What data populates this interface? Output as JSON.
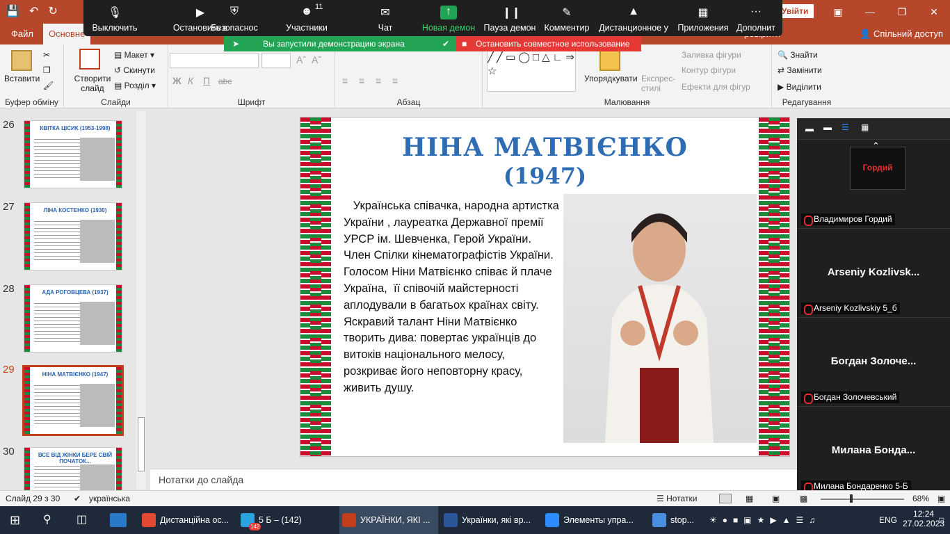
{
  "titlebar": {
    "signin": "Увійти"
  },
  "tabs": {
    "file": "Файл",
    "home": "Основне",
    "share": "Спільний доступ",
    "extra": "ревірити"
  },
  "ribbon": {
    "paste": "Вставити",
    "clipboard": "Буфер обміну",
    "new_slide": "Створити слайд",
    "layout": "Макет",
    "reset": "Скинути",
    "section": "Розділ",
    "slides": "Слайди",
    "bold": "Ж",
    "italic": "К",
    "underline": "П",
    "strike": "abc",
    "font": "Шрифт",
    "paragraph": "Абзац",
    "arrange": "Упорядкувати",
    "quick_styles": "Експрес-стилі",
    "fill": "Заливка фігури",
    "outline": "Контур фігури",
    "effects": "Ефекти для фігур",
    "drawing": "Малювання",
    "find": "Знайти",
    "replace": "Замінити",
    "select": "Виділити",
    "editing": "Редагування"
  },
  "zoom": {
    "items": [
      {
        "icon": "microphone-icon",
        "label": "Выключить"
      },
      {
        "icon": "video-icon",
        "label": "Остановить в"
      },
      {
        "icon": "shield-icon",
        "label": "Безопаснос"
      },
      {
        "icon": "participants-icon",
        "label": "Участники",
        "badge": "11"
      },
      {
        "icon": "chat-icon",
        "label": "Чат"
      },
      {
        "icon": "share-screen-icon",
        "label": "Новая демон"
      },
      {
        "icon": "pause-icon",
        "label": "Пауза демон"
      },
      {
        "icon": "pen-icon",
        "label": "Комментир"
      },
      {
        "icon": "remote-control-icon",
        "label": "Дистанционное у"
      },
      {
        "icon": "apps-icon",
        "label": "Приложения"
      },
      {
        "icon": "more-icon",
        "label": "Дополнит"
      }
    ],
    "banner_share": "Вы запустили демонстрацию экрана",
    "banner_stop": "Остановить совместное использование",
    "participants": [
      {
        "big": "",
        "name": "Владимиров Гордий",
        "logo": "Гордий"
      },
      {
        "big": "Arseniy  Kozlivsk...",
        "name": "Arseniy Kozlivskiy 5_б"
      },
      {
        "big": "Богдан  Золоче...",
        "name": "Богдан Золочевський"
      },
      {
        "big": "Милана  Бонда...",
        "name": "Милана Бондаренко 5-Б"
      }
    ]
  },
  "thumbnails": [
    {
      "num": "26",
      "title": "КВІТКА ЦІСИК (1953-1998)"
    },
    {
      "num": "27",
      "title": "ЛІНА КОСТЕНКО (1930)"
    },
    {
      "num": "28",
      "title": "АДА РОГОВЦЕВА (1937)"
    },
    {
      "num": "29",
      "title": "НІНА МАТВІЄНКО (1947)"
    },
    {
      "num": "30",
      "title": "ВСЕ ВІД ЖІНКИ БЕРЕ СВІЙ ПОЧАТОК..."
    }
  ],
  "slide": {
    "title": "НІНА МАТВІЄНКО",
    "years": "(1947)",
    "text": "   Українська співачка, народна артистка України , лауреатка Державної премії УРСР ім. Шевченка, Герой України. Член Спілки кінематографістів України. Голосом Ніни Матвієнко співає й плаче Україна,  її співочій майстерності аплодували в багатьох країнах світу. Яскравий талант Ніни Матвієнко творить дива: повертає українців до витоків національного мелосу, розкриває його неповторну красу, живить душу."
  },
  "notes_placeholder": "Нотатки до слайда",
  "status": {
    "slide_of": "Слайд 29 з 30",
    "language": "українська",
    "notes": "Нотатки",
    "zoom": "68%"
  },
  "taskbar": {
    "apps": [
      {
        "label": "Дистанційна ос...",
        "color": "#e34a33"
      },
      {
        "label": "5 Б – (142)",
        "color": "#2aa3df",
        "badge": "142"
      },
      {
        "label": "УКРАЇНКИ, ЯКІ ...",
        "color": "#c43e1c"
      },
      {
        "label": "Українки, які вр...",
        "color": "#2b579a"
      },
      {
        "label": "Элементы упра...",
        "color": "#2d8cff"
      },
      {
        "label": "stop...",
        "color": "#4a90e2"
      }
    ],
    "lang": "ENG",
    "time": "12:24",
    "date": "27.02.2023"
  },
  "colors": {
    "accent": "#b7472a",
    "zoom_green": "#23a455",
    "zoom_red": "#e53935",
    "title_blue": "#2e6db4"
  }
}
